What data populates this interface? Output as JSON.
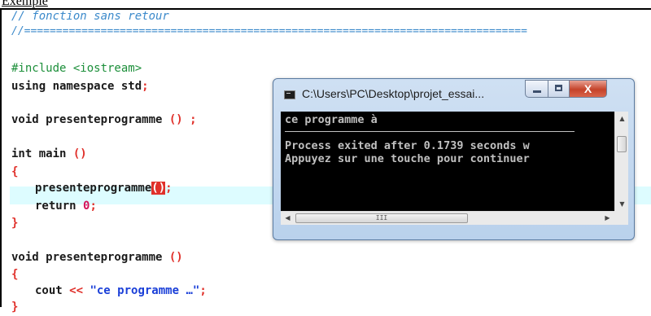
{
  "caption": "Exemple",
  "editor": {
    "comment_title": "// fonction sans retour",
    "comment_sep": "//===============================================================================",
    "include": "#include <iostream>",
    "using_kw": "using namespace std",
    "semicolon": ";",
    "decl_name": "void presenteprogramme ",
    "decl_parens": "() ;",
    "main_sig": "int main ",
    "main_parens": "()",
    "brace_open": "{",
    "call_name": "presenteprogramme",
    "call_parens": "()",
    "call_semi": ";",
    "return_kw": "return ",
    "return_val": "0",
    "brace_close": "}",
    "def_name": "void presenteprogramme ",
    "def_parens": "()",
    "cout_kw": "cout ",
    "cout_op": "<<",
    "cout_str": " \"ce programme …\"",
    "cout_semi": ";"
  },
  "console": {
    "title": "C:\\Users\\PC\\Desktop\\projet_essai...",
    "close_label": "X",
    "lines": [
      "ce programme à",
      "Process exited after 0.1739 seconds w",
      "Appuyez sur une touche pour continuer"
    ],
    "scroll_up": "▲",
    "scroll_down": "▼",
    "scroll_left": "◀",
    "scroll_right": "▶",
    "thumb_grip": "III"
  },
  "colors": {
    "comment": "#3c8acb",
    "preprocessor": "#1c8f3a",
    "string": "#1a3fd8",
    "number": "#d4145a",
    "brace": "#e0302a",
    "highlight_line": "#ddfcff"
  }
}
